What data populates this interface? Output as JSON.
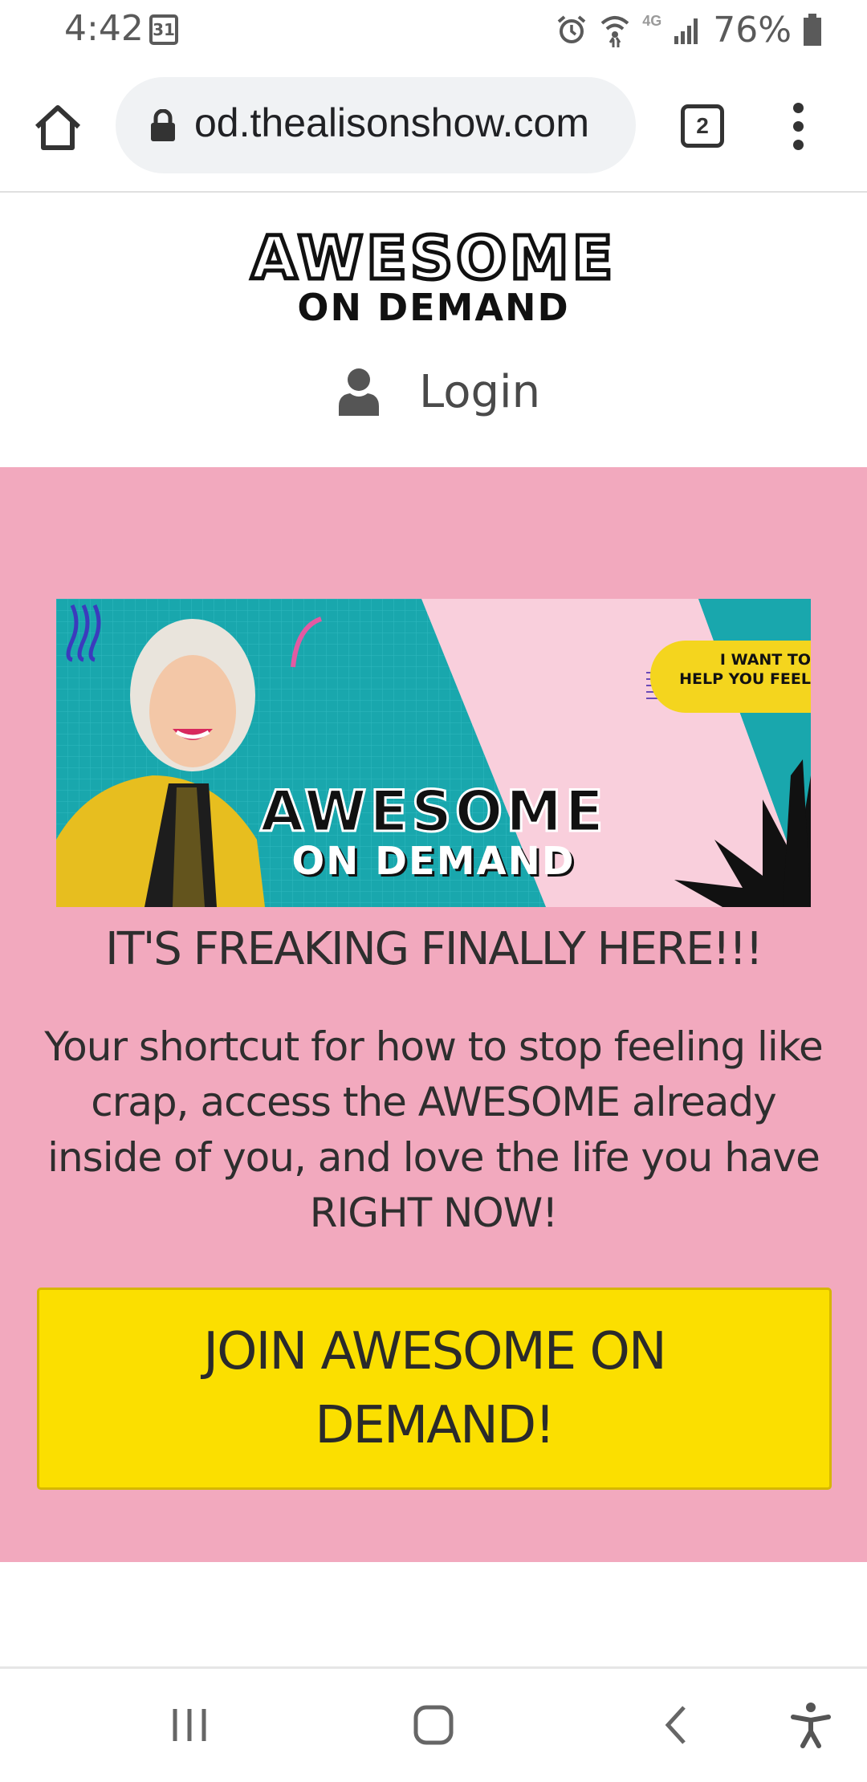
{
  "status_bar": {
    "time": "4:42",
    "calendar_day": "31",
    "network": "4G",
    "battery": "76%"
  },
  "browser": {
    "url": "od.thealisonshow.com",
    "tab_count": "2"
  },
  "header": {
    "logo_line1": "AWESOME",
    "logo_line2": "ON DEMAND",
    "login_label": "Login"
  },
  "hero": {
    "banner": {
      "callout": "I WANT TO\nHELP YOU FEEL",
      "logo_line1": "AWESOME",
      "logo_line2": "ON DEMAND"
    },
    "headline": "IT'S FREAKING FINALLY HERE!!!",
    "subtext": "Your shortcut for how to stop feeling like crap, access the AWESOME already inside of you, and love the life you have RIGHT NOW!",
    "cta_label": "JOIN AWESOME ON DEMAND!"
  },
  "colors": {
    "hero_background": "#f2a9be",
    "cta_background": "#fbdf00",
    "banner_teal": "#19a7ad",
    "banner_pink": "#f9cfdc",
    "callout_yellow": "#f4d51e"
  },
  "icons": {
    "home": "home-icon",
    "lock": "lock-icon",
    "tabs": "tabs-icon",
    "menu": "more-vert-icon",
    "user": "user-icon",
    "recents": "recents-icon",
    "home_nav": "home-nav-icon",
    "back": "back-icon",
    "accessibility": "accessibility-icon"
  }
}
